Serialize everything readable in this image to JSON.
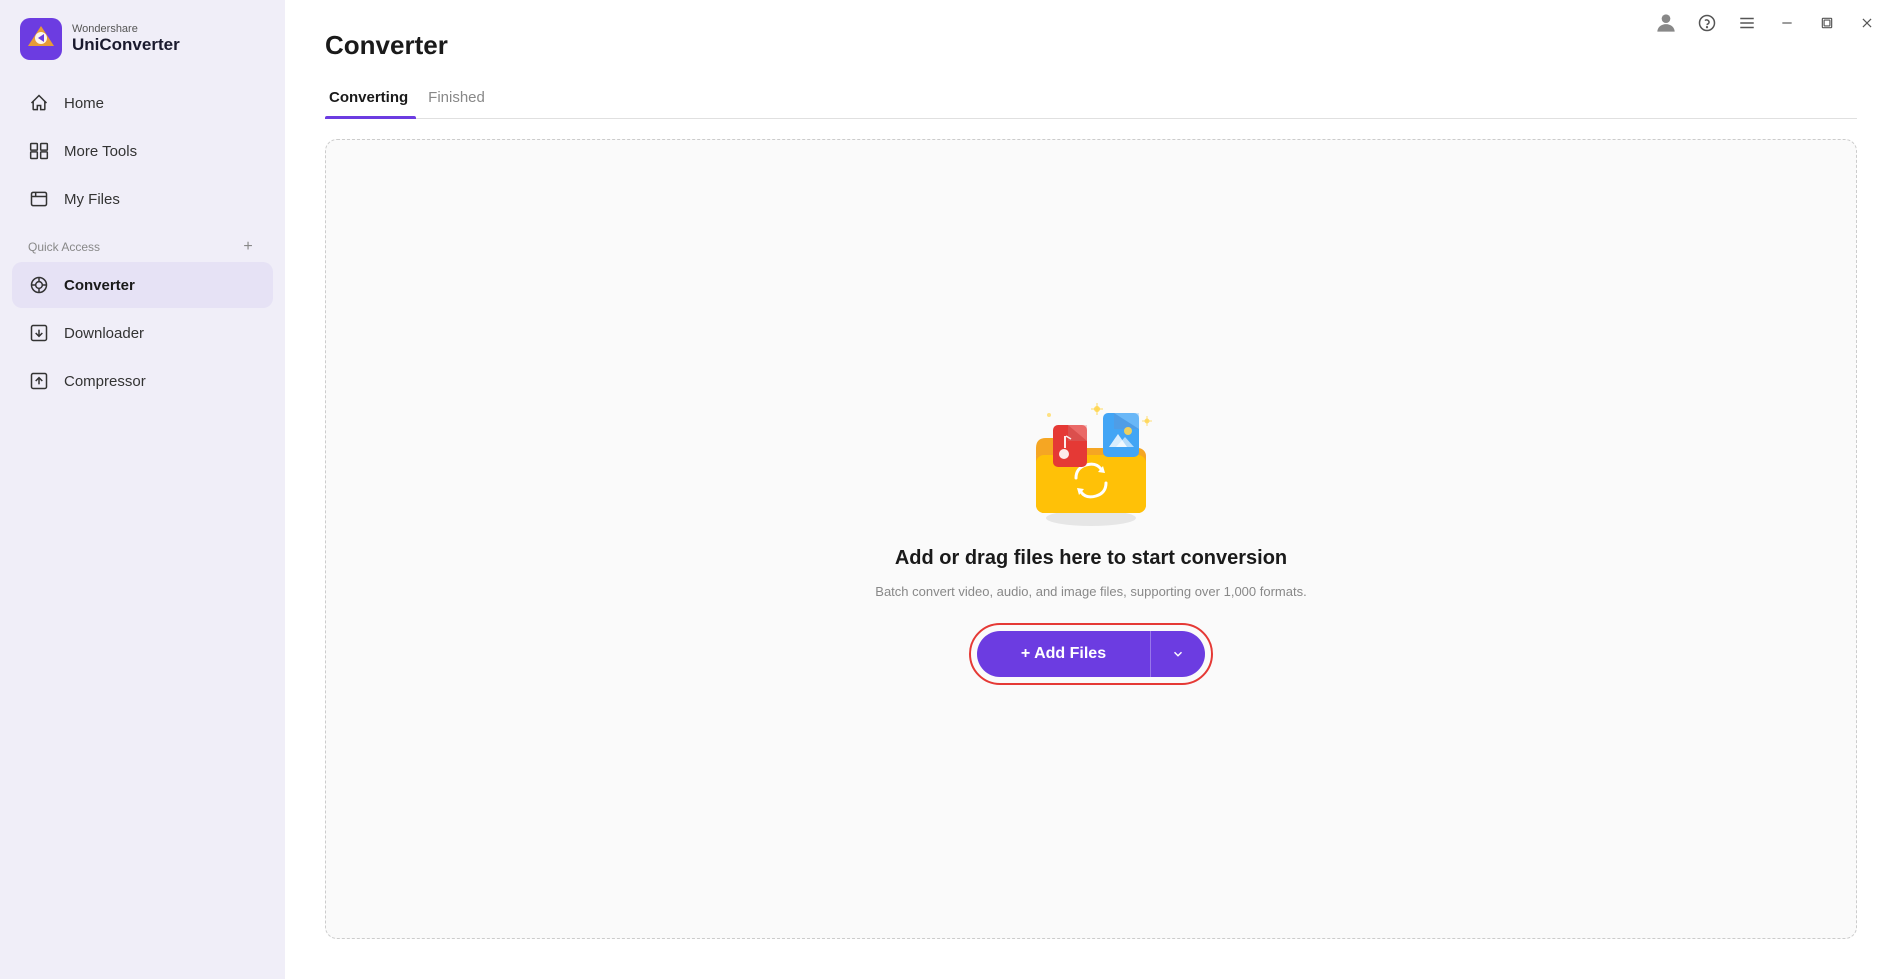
{
  "app": {
    "brand_top": "Wondershare",
    "brand_bottom": "UniConverter",
    "title": "Converter"
  },
  "sidebar": {
    "items": [
      {
        "id": "home",
        "label": "Home",
        "icon": "home"
      },
      {
        "id": "more-tools",
        "label": "More Tools",
        "icon": "more-tools"
      },
      {
        "id": "my-files",
        "label": "My Files",
        "icon": "my-files"
      }
    ],
    "quick_access_label": "Quick Access",
    "quick_access_items": [
      {
        "id": "converter",
        "label": "Converter",
        "icon": "converter",
        "active": true
      },
      {
        "id": "downloader",
        "label": "Downloader",
        "icon": "downloader"
      },
      {
        "id": "compressor",
        "label": "Compressor",
        "icon": "compressor"
      }
    ]
  },
  "tabs": [
    {
      "id": "converting",
      "label": "Converting",
      "active": true
    },
    {
      "id": "finished",
      "label": "Finished",
      "active": false
    }
  ],
  "drop_zone": {
    "title": "Add or drag files here to start conversion",
    "subtitle": "Batch convert video, audio, and image files, supporting over 1,000 formats."
  },
  "add_files_button": {
    "main_label": "+ Add Files",
    "dropdown_label": "▾"
  },
  "titlebar": {
    "user_icon": "user",
    "help_icon": "help",
    "menu_icon": "menu",
    "minimize_icon": "minimize",
    "maximize_icon": "maximize",
    "close_icon": "close"
  }
}
